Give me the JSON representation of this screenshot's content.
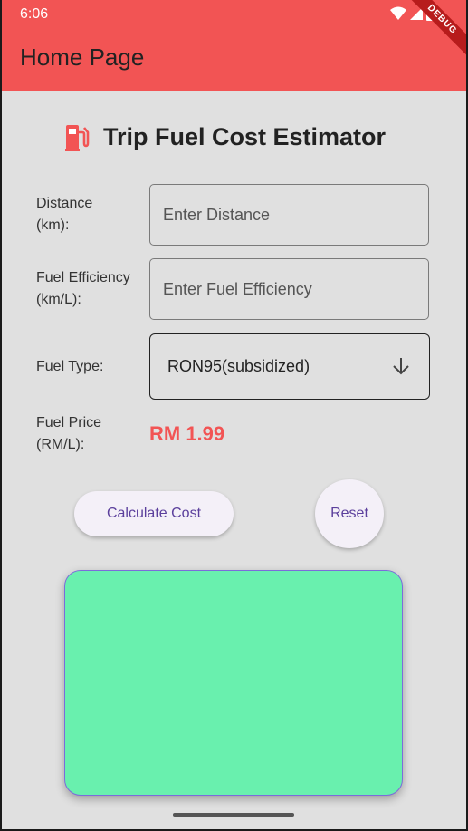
{
  "status_bar": {
    "time": "6:06",
    "debug_label": "DEBUG"
  },
  "appbar": {
    "title": "Home Page"
  },
  "header": {
    "title": "Trip Fuel Cost Estimator",
    "icon": "fuel-pump-icon"
  },
  "form": {
    "distance": {
      "label_line1": "Distance",
      "label_line2": "(km):",
      "placeholder": "Enter Distance",
      "value": ""
    },
    "efficiency": {
      "label_line1": "Fuel Efficiency",
      "label_line2": "(km/L):",
      "placeholder": "Enter Fuel Efficiency",
      "value": ""
    },
    "fuel_type": {
      "label": "Fuel Type:",
      "selected": "RON95(subsidized)"
    },
    "fuel_price": {
      "label_line1": "Fuel Price",
      "label_line2": "(RM/L):",
      "value": "RM 1.99"
    }
  },
  "buttons": {
    "calculate": "Calculate Cost",
    "reset": "Reset"
  },
  "colors": {
    "appbar": "#f25454",
    "accent": "#f25454",
    "result_card": "#69f0ae",
    "button_text": "#5b3f9c"
  }
}
